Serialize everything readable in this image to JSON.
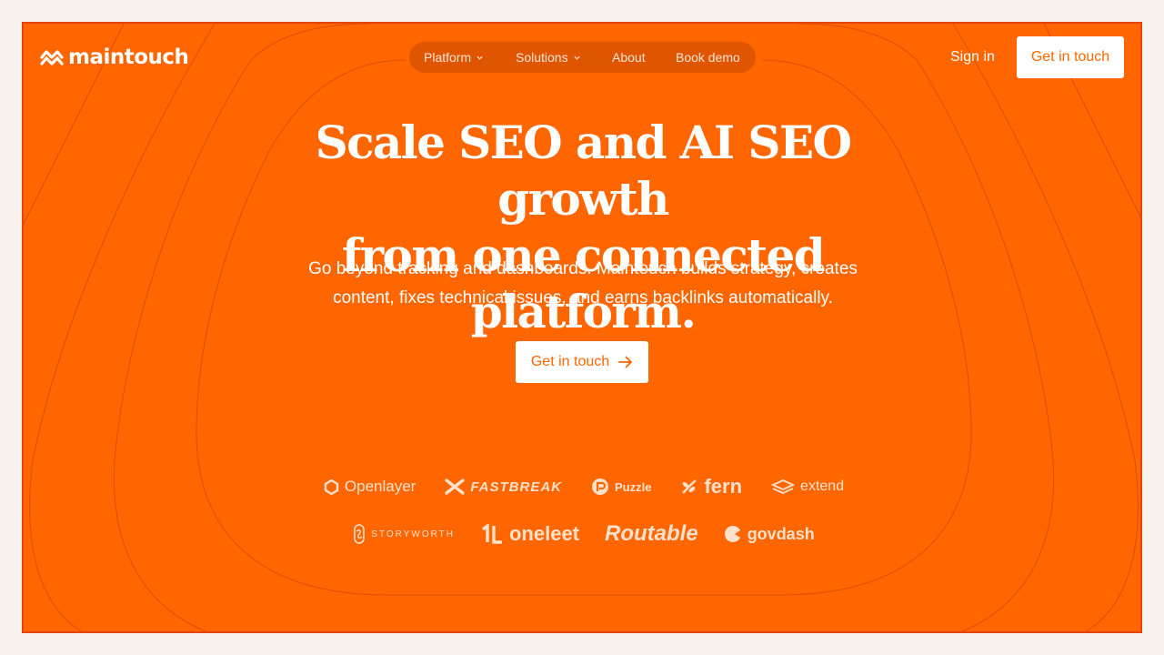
{
  "brand": {
    "name": "maintouch"
  },
  "nav": {
    "items": [
      {
        "label": "Platform",
        "has_dropdown": true
      },
      {
        "label": "Solutions",
        "has_dropdown": true
      },
      {
        "label": "About",
        "has_dropdown": false
      },
      {
        "label": "Book demo",
        "has_dropdown": false
      }
    ]
  },
  "header": {
    "sign_in": "Sign in",
    "cta": "Get in touch"
  },
  "hero": {
    "headline_line1": "Scale SEO and AI SEO growth",
    "headline_line2": "from one connected platform.",
    "subtext_line1": "Go beyond tracking and dashboards. Maintouch builds strategy, creates",
    "subtext_line2": "content, fixes technical issues, and earns backlinks automatically.",
    "cta": "Get in touch"
  },
  "customers": {
    "row1": [
      "Openlayer",
      "FASTBREAK",
      "Puzzle",
      "fern",
      "extend"
    ],
    "row2": [
      "STORYWORTH",
      "oneleet",
      "Routable",
      "govdash"
    ]
  },
  "colors": {
    "page_bg": "#f7f2ec",
    "accent": "#ff6600",
    "nav_bg": "#e05500",
    "border": "#e2460c",
    "text": "#ffffff"
  },
  "icons": [
    "maintouch-logo-icon",
    "chevron-down-icon",
    "arrow-right-icon"
  ]
}
